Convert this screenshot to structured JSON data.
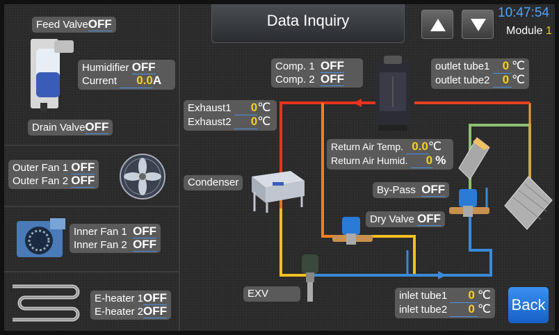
{
  "header": {
    "title": "Data Inquiry",
    "time": "10:47:54",
    "module_label": "Module",
    "module_number": "1",
    "back_label": "Back"
  },
  "left_panel": {
    "feed_valve": {
      "label": "Feed Valve",
      "value": "OFF"
    },
    "humidifier": {
      "label": "Humidifier",
      "value": "OFF"
    },
    "current": {
      "label": "Current",
      "value": "0.0",
      "unit": "A"
    },
    "drain_valve": {
      "label": "Drain Valve",
      "value": "OFF"
    },
    "outer_fan_1": {
      "label": "Outer Fan 1",
      "value": "OFF"
    },
    "outer_fan_2": {
      "label": "Outer Fan 2",
      "value": "OFF"
    },
    "inner_fan_1": {
      "label": "Inner Fan 1",
      "value": "OFF"
    },
    "inner_fan_2": {
      "label": "Inner Fan 2",
      "value": "OFF"
    },
    "e_heater_1": {
      "label": "E-heater 1",
      "value": "OFF"
    },
    "e_heater_2": {
      "label": "E-heater 2",
      "value": "OFF"
    }
  },
  "diagram": {
    "comp1": {
      "label": "Comp. 1",
      "value": "OFF"
    },
    "comp2": {
      "label": "Comp. 2",
      "value": "OFF"
    },
    "outlet_tube1": {
      "label": "outlet tube1",
      "value": "0",
      "unit": "℃"
    },
    "outlet_tube2": {
      "label": "outlet tube2",
      "value": "0",
      "unit": "℃"
    },
    "exhaust1": {
      "label": "Exhaust1",
      "value": "0",
      "unit": "℃"
    },
    "exhaust2": {
      "label": "Exhaust2",
      "value": "0",
      "unit": "℃"
    },
    "return_air_temp": {
      "label": "Return Air Temp.",
      "value": "0.0",
      "unit": "℃"
    },
    "return_air_humid": {
      "label": "Return Air Humid.",
      "value": "0",
      "unit": "%"
    },
    "condenser": {
      "label": "Condenser"
    },
    "bypass": {
      "label": "By-Pass",
      "value": "OFF"
    },
    "dry_valve": {
      "label": "Dry Valve",
      "value": "OFF"
    },
    "exv": {
      "label": "EXV"
    },
    "inlet_tube1": {
      "label": "inlet tube1",
      "value": "0",
      "unit": "℃"
    },
    "inlet_tube2": {
      "label": "inlet tube2",
      "value": "0",
      "unit": "℃"
    }
  },
  "colors": {
    "hot_pipe": "#e8321e",
    "warm_pipe": "#f0a020",
    "cold_pipe": "#3a8ad8",
    "value_yellow": "#f5d020",
    "clock_blue": "#4fa3ff",
    "back_blue": "#2a7ae8"
  },
  "icons": [
    "up-arrow-icon",
    "down-arrow-icon",
    "humidifier-icon",
    "axial-fan-icon",
    "centrifugal-fan-icon",
    "heater-coil-icon",
    "compressor-icon",
    "condenser-icon",
    "solenoid-valve-icon",
    "expansion-valve-icon",
    "evaporator-coil-icon"
  ]
}
